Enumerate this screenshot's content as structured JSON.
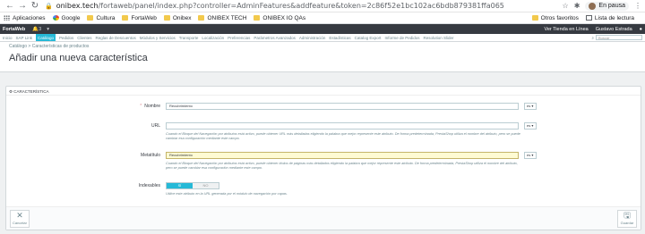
{
  "browser": {
    "url_host": "onibex.tech",
    "url_path": "/fortaweb/panel/index.php?controller=AdminFeatures&addfeature&token=2c86f52e1bc102ac6bdb879381ffa065",
    "profile_label": "En pausa"
  },
  "bookmarks": {
    "items": [
      "Aplicaciones",
      "Google",
      "Cultura",
      "FortaWeb",
      "Onibex",
      "ONIBEX TECH",
      "ONIBEX IO QAs"
    ],
    "right": [
      "Otros favoritos",
      "Lista de lectura"
    ]
  },
  "admin": {
    "brand": "FortaWeb",
    "notif_count": "3",
    "quick_access": "Acceso rápido",
    "store": "Ver Tienda en Línea",
    "user": "Gustavo Estrada"
  },
  "tabs": {
    "items": [
      "Inicio",
      "SAP Link",
      "Catálogo",
      "Pedidos",
      "Clientes",
      "Reglas de Descuentos",
      "Módulos y Servicios",
      "Transporte",
      "Localización",
      "Preferencias",
      "Parámetros Avanzados",
      "Administración",
      "Estadísticas",
      "Catalog Export",
      "Informe de Pedidos",
      "Resolution Slider"
    ],
    "search_placeholder": "Buscar"
  },
  "page": {
    "breadcrumb_1": "Catálogo",
    "breadcrumb_2": "Características de productos",
    "title": "Añadir una nueva característica"
  },
  "form": {
    "panel_title": "CARACTERÍSTICA",
    "name_label": "Nombre",
    "name_value": "Recubrimiento",
    "lang": "es",
    "url_label": "URL",
    "url_help": "Cuando el Bloque del Navegación por atributos está activo, puede obtener URL más detalladas eligiendo la palabra que mejor represente este atributo. De forma predeterminada, PrestaShop utiliza el nombre del atributo, pero se puede cambiar esa configuración mediante este campo.",
    "meta_label": "Metatítulo",
    "meta_value": "Recubrimiento",
    "meta_help": "Cuando el Bloque del Navegación por atributos está activo, puede obtener títulos de páginas más detallados eligiendo la palabra que mejor represente este atributo. De forma predeterminada, PrestaShop utiliza el nombre del atributo, pero se puede cambiar esa configuración mediante este campo.",
    "indexable_label": "Indexables",
    "yes": "SÍ",
    "no": "NO",
    "indexable_help": "Utilice este atributo en la URL generada por el módulo de navegación por capas.",
    "cancel": "Cancelar",
    "save": "Guardar"
  }
}
